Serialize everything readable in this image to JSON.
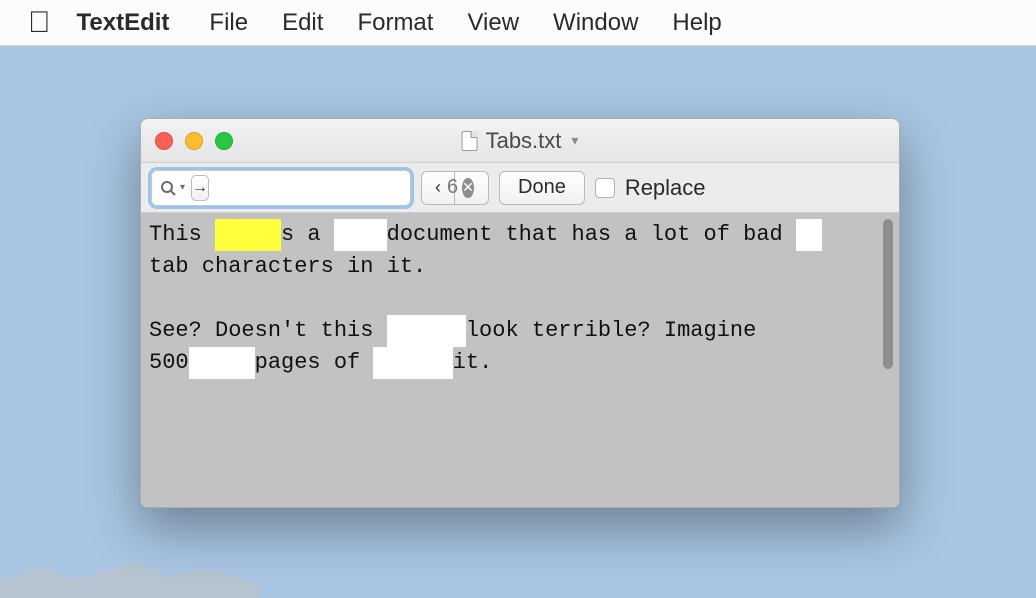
{
  "menubar": {
    "app": "TextEdit",
    "items": [
      "File",
      "Edit",
      "Format",
      "View",
      "Window",
      "Help"
    ]
  },
  "window": {
    "title": "Tabs.txt"
  },
  "find": {
    "value": "",
    "count": "6",
    "done": "Done",
    "replace_label": "Replace"
  },
  "doc": {
    "l1a": "This ",
    "l1b": "s a ",
    "l1c": "document that has a lot of bad ",
    "l2": "tab characters in it.",
    "l3a": "See? Doesn't this ",
    "l3b": "look terrible? Imagine",
    "l4a": "500",
    "l4b": "pages of ",
    "l4c": "it."
  }
}
